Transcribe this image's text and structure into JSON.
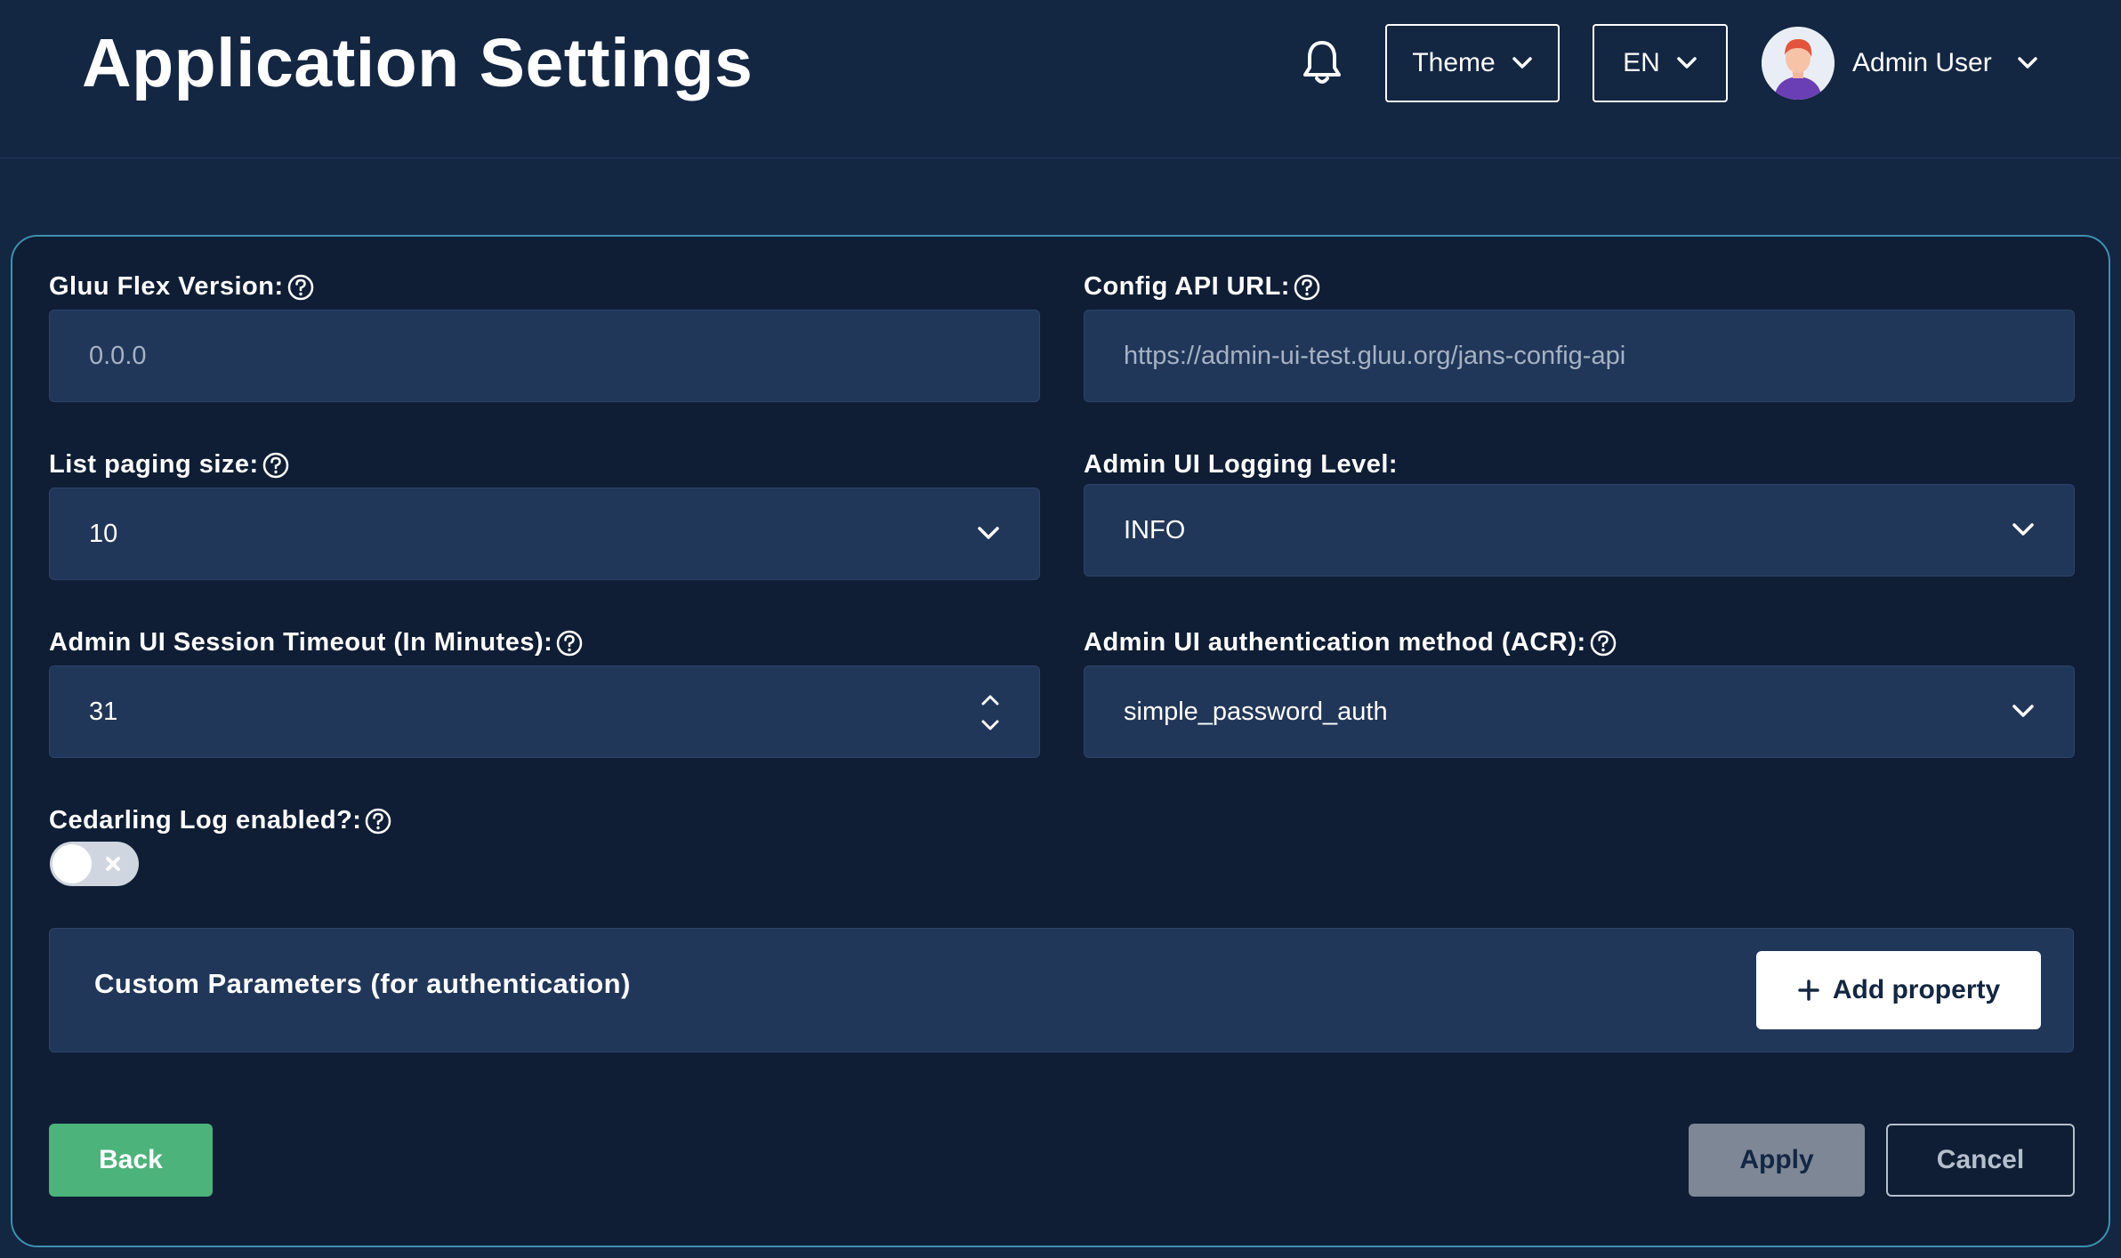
{
  "header": {
    "title": "Application Settings",
    "theme_label": "Theme",
    "language_label": "EN",
    "user_name": "Admin User"
  },
  "form": {
    "gluu_flex_version": {
      "label": "Gluu Flex Version:",
      "value": "0.0.0"
    },
    "config_api_url": {
      "label": "Config API URL:",
      "value": "https://admin-ui-test.gluu.org/jans-config-api"
    },
    "list_paging_size": {
      "label": "List paging size:",
      "value": "10"
    },
    "logging_level": {
      "label": "Admin UI Logging Level:",
      "value": "INFO"
    },
    "session_timeout": {
      "label": "Admin UI Session Timeout (In Minutes):",
      "value": "31"
    },
    "auth_method": {
      "label": "Admin UI authentication method (ACR):",
      "value": "simple_password_auth"
    },
    "cedarling_log": {
      "label": "Cedarling Log enabled?:",
      "enabled": false
    }
  },
  "custom_params": {
    "title": "Custom Parameters (for authentication)",
    "add_label": "Add property"
  },
  "actions": {
    "back_label": "Back",
    "apply_label": "Apply",
    "cancel_label": "Cancel"
  },
  "colors": {
    "background": "#132642",
    "card": "#0f1e35",
    "input": "#213759",
    "card_border": "#3f8fae",
    "back_button": "#4cb37a",
    "apply_button": "#7d8796"
  }
}
